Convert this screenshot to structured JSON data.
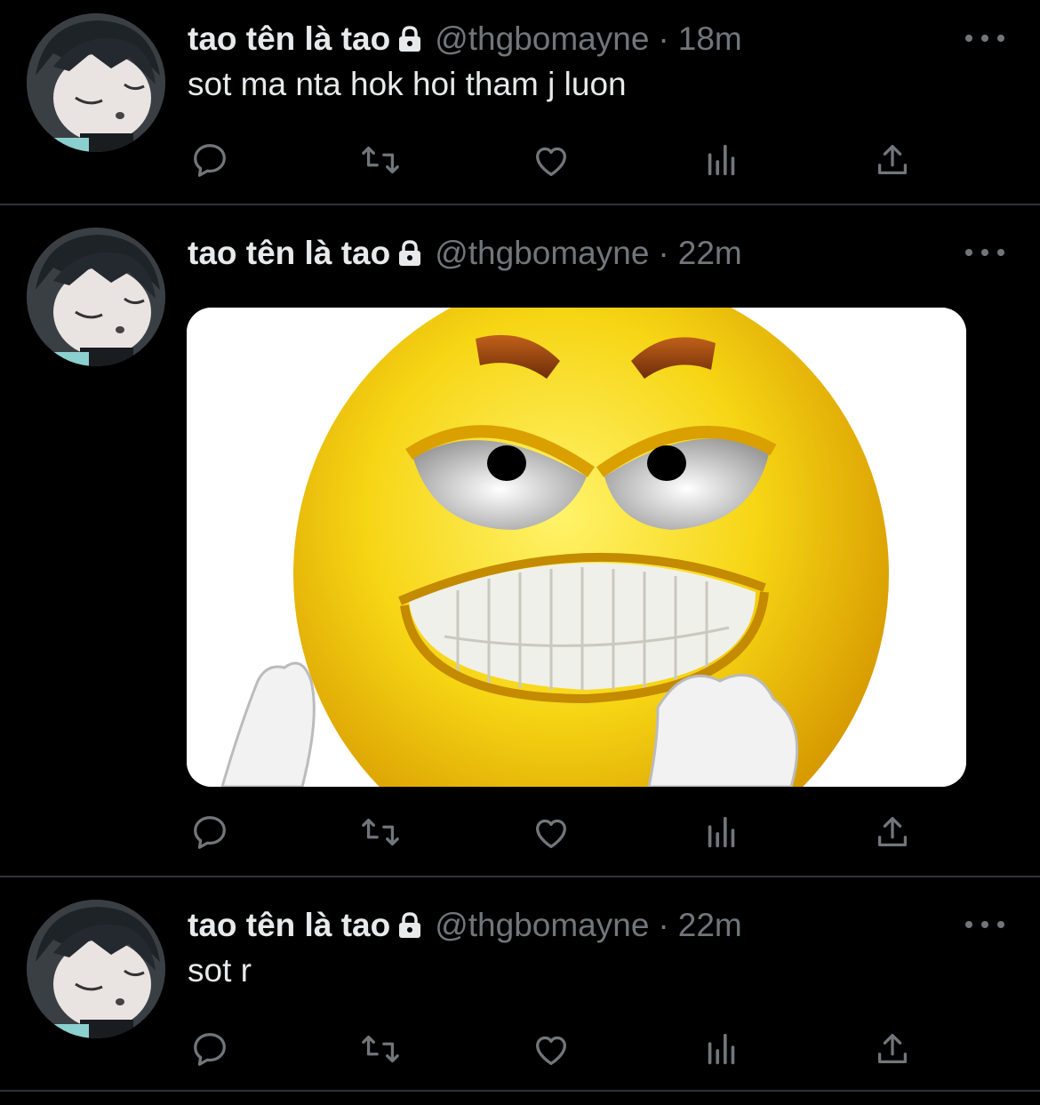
{
  "tweets": [
    {
      "author": {
        "name": "tao tên là tao",
        "handle": "@thgbomayne"
      },
      "separator": "·",
      "time": "18m",
      "text": "sot ma nta hok hoi tham j luon",
      "has_media": false
    },
    {
      "author": {
        "name": "tao tên là tao",
        "handle": "@thgbomayne"
      },
      "separator": "·",
      "time": "22m",
      "text": "",
      "has_media": true,
      "media": {
        "description_icon": "angry-emoji-image"
      }
    },
    {
      "author": {
        "name": "tao tên là tao",
        "handle": "@thgbomayne"
      },
      "separator": "·",
      "time": "22m",
      "text": "sot r",
      "has_media": false
    }
  ],
  "icons": {
    "protected": "lock-icon",
    "more": "more-horizontal-icon",
    "actions": [
      "reply-icon",
      "retweet-icon",
      "like-icon",
      "analytics-icon",
      "share-icon"
    ]
  },
  "colors": {
    "background": "#000000",
    "primary_text": "#e7e9ea",
    "secondary_text": "#71767b",
    "divider": "#2f3336"
  }
}
